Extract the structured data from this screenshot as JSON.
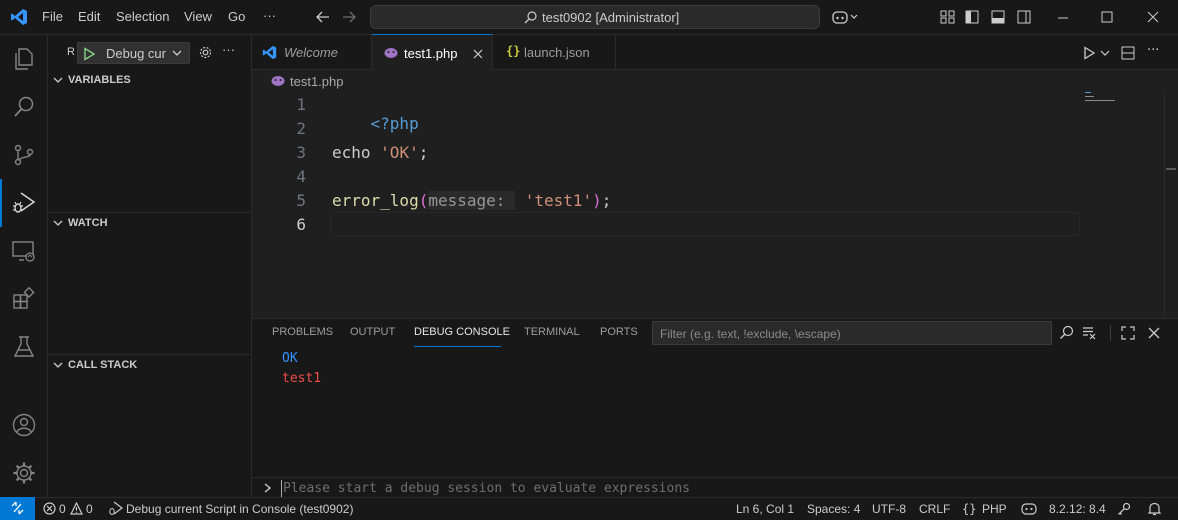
{
  "titlebar": {
    "menu": [
      "File",
      "Edit",
      "Selection",
      "View",
      "Go"
    ],
    "more": "···",
    "command_center": "test0902 [Administrator]"
  },
  "sidebar": {
    "run_label": "Debug cur",
    "run_prefix": "R",
    "more": "···",
    "sections": [
      "VARIABLES",
      "WATCH",
      "CALL STACK"
    ]
  },
  "tabs": [
    {
      "label": "Welcome"
    },
    {
      "label": "test1.php"
    },
    {
      "label": "launch.json"
    }
  ],
  "breadcrumb": "test1.php",
  "editor": {
    "lines": [
      "1",
      "2",
      "3",
      "4",
      "5",
      "6"
    ],
    "code_php_open": "<?php",
    "code_echo": "echo ",
    "code_echo_str": "'OK'",
    "code_semicolon": ";",
    "code_fn": "error_log",
    "code_paren_open": "(",
    "code_hint": "message: ",
    "code_arg": "'test1'",
    "code_paren_close": ")",
    "code_end": ";"
  },
  "panel": {
    "tabs": [
      "PROBLEMS",
      "OUTPUT",
      "DEBUG CONSOLE",
      "TERMINAL",
      "PORTS"
    ],
    "filter_placeholder": "Filter (e.g. text, !exclude, \\escape)",
    "output": [
      "OK",
      "test1"
    ],
    "input_placeholder": "Please start a debug session to evaluate expressions"
  },
  "statusbar": {
    "errors": "0",
    "warnings": "0",
    "debug_target": "Debug current Script in Console (test0902)",
    "position": "Ln 6, Col 1",
    "spaces": "Spaces: 4",
    "encoding": "UTF-8",
    "eol": "CRLF",
    "language_brace": "{}",
    "language": "PHP",
    "php_version": "8.2.12: 8.4"
  },
  "colors": {
    "accent": "#0078d4",
    "keyword": "#569cd6",
    "string": "#ce9178",
    "function": "#dcdcaa",
    "error_red": "#f14c4c",
    "console_blue": "#3794ff"
  }
}
